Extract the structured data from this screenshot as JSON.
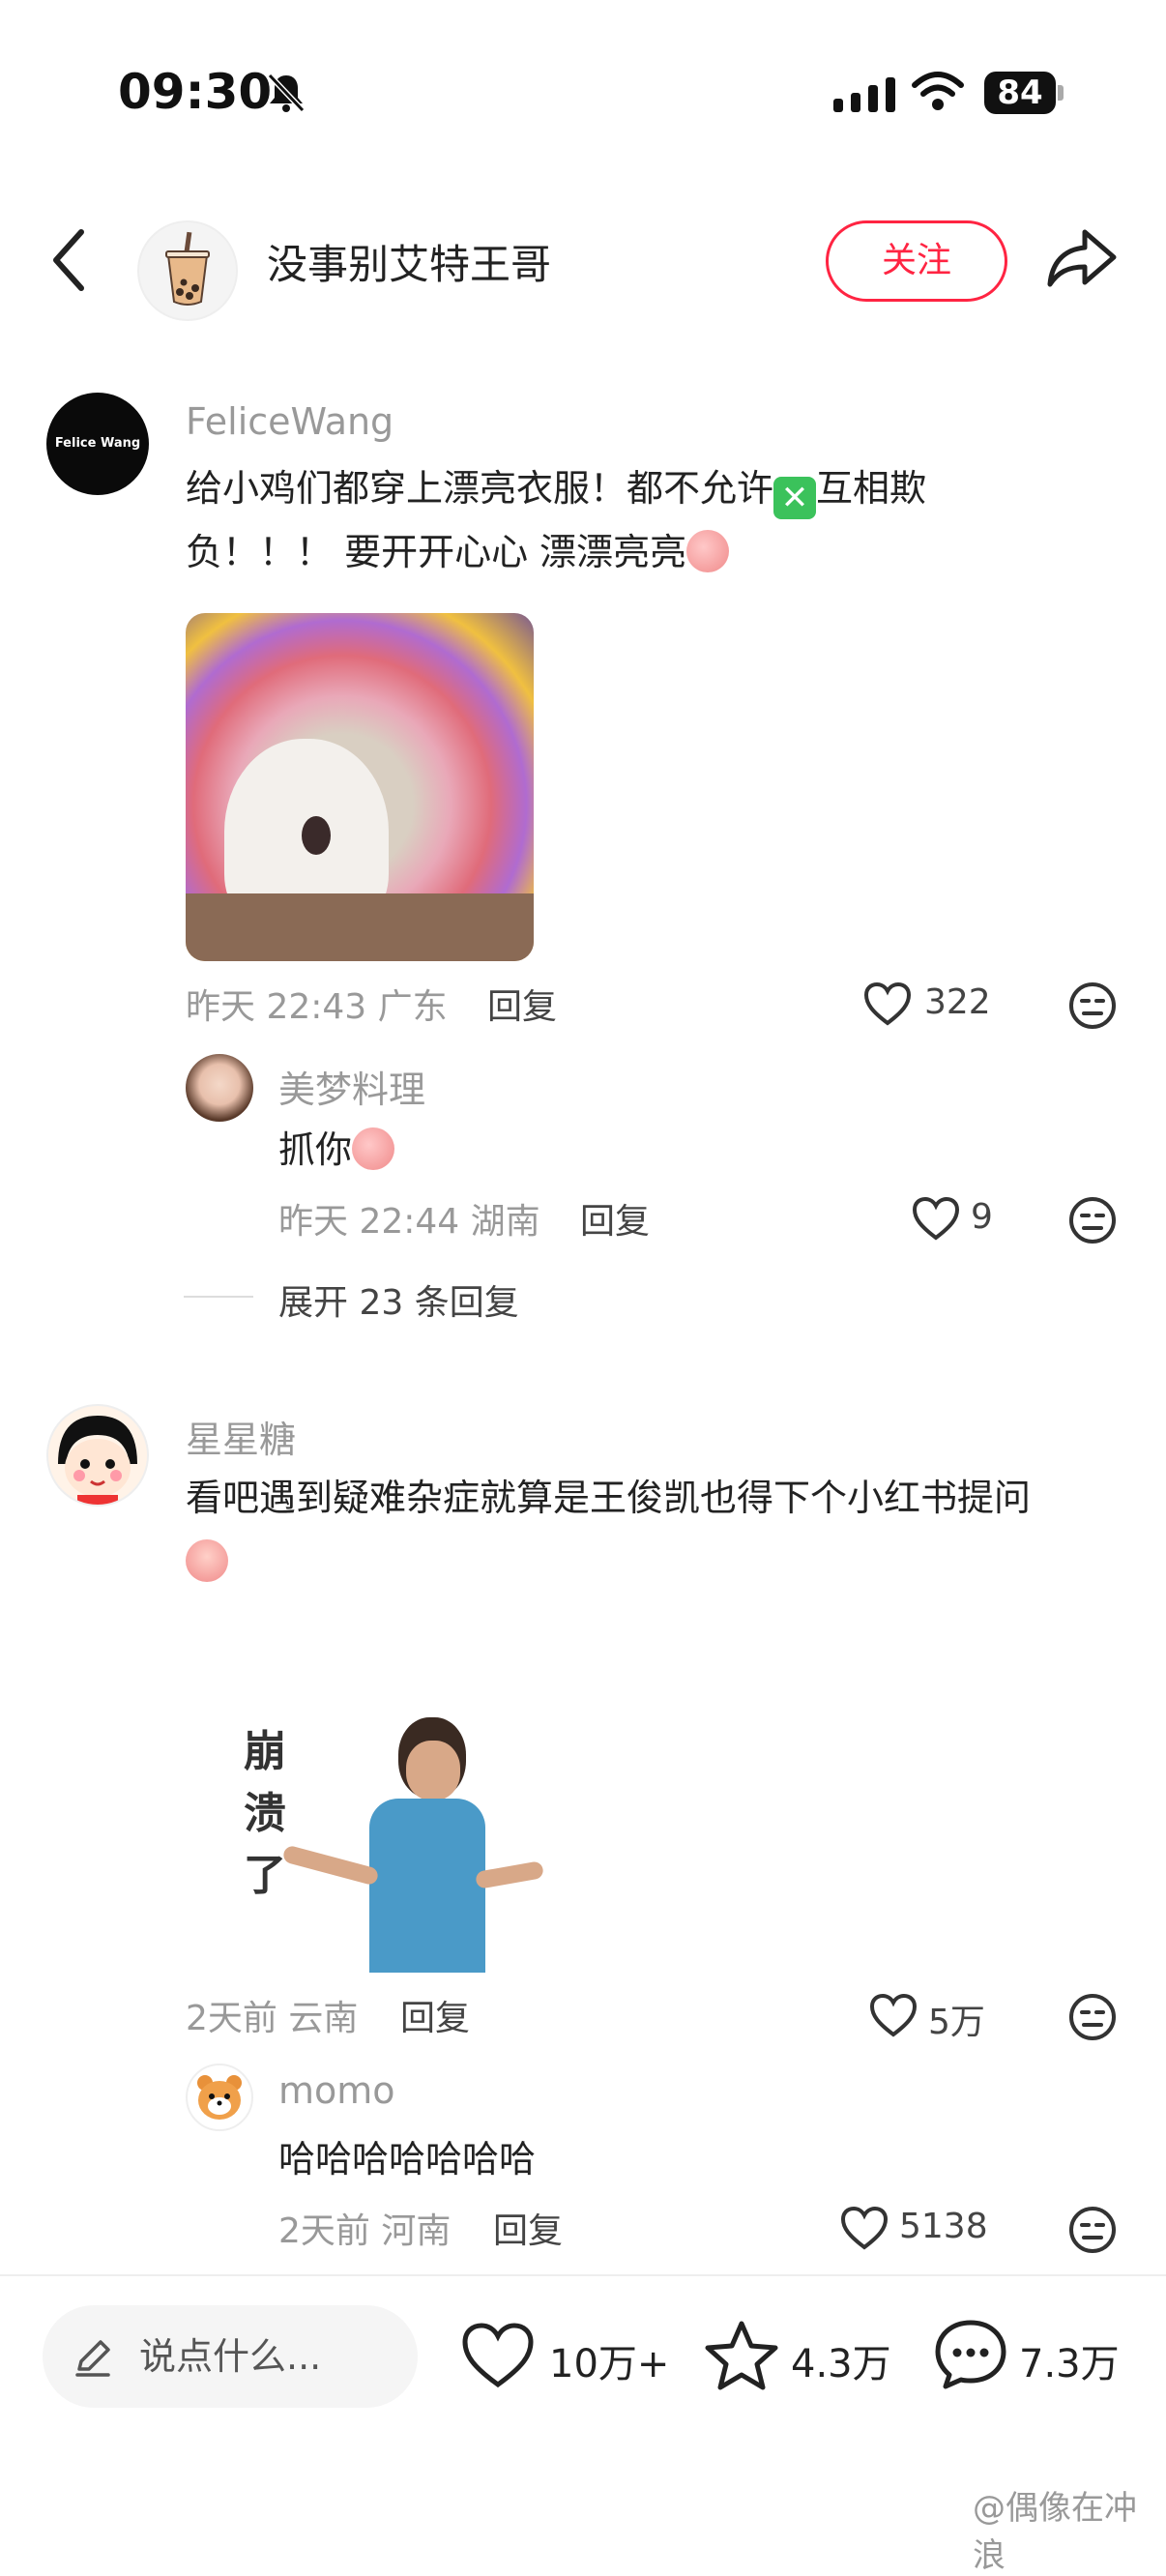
{
  "status_bar": {
    "time": "09:30",
    "battery": "84"
  },
  "header": {
    "author": "没事别艾特王哥",
    "follow_label": "关注"
  },
  "comments": [
    {
      "user": "FeliceWang",
      "avatar_text": "Felice Wang",
      "text_line1": "给小鸡们都穿上漂亮衣服！都不允许",
      "text_line1_b": "互相欺",
      "text_line2": "负！！！ 要开开心心 漂漂亮亮",
      "meta": "昨天 22:43 广东",
      "reply_label": "回复",
      "likes": "322",
      "sub_reply": {
        "user": "美梦料理",
        "text": "抓你",
        "meta": "昨天 22:44 湖南",
        "reply_label": "回复",
        "likes": "9"
      },
      "expand_label": "展开 23 条回复"
    },
    {
      "user": "星星糖",
      "text_line1": "看吧遇到疑难杂症就算是王俊凯也得下个小红书提问",
      "sticker_text": [
        "崩",
        "溃",
        "了"
      ],
      "meta": "2天前 云南",
      "reply_label": "回复",
      "likes": "5万",
      "sub_reply": {
        "user": "momo",
        "text": "哈哈哈哈哈哈哈",
        "meta": "2天前 河南",
        "reply_label": "回复",
        "likes": "5138"
      }
    }
  ],
  "bottom_bar": {
    "input_placeholder": "说点什么...",
    "likes": "10万+",
    "stars": "4.3万",
    "comments": "7.3万"
  },
  "watermark": "@偶像在冲浪",
  "colors": {
    "accent": "#ff2442",
    "meta": "#999999",
    "text": "#222222"
  }
}
